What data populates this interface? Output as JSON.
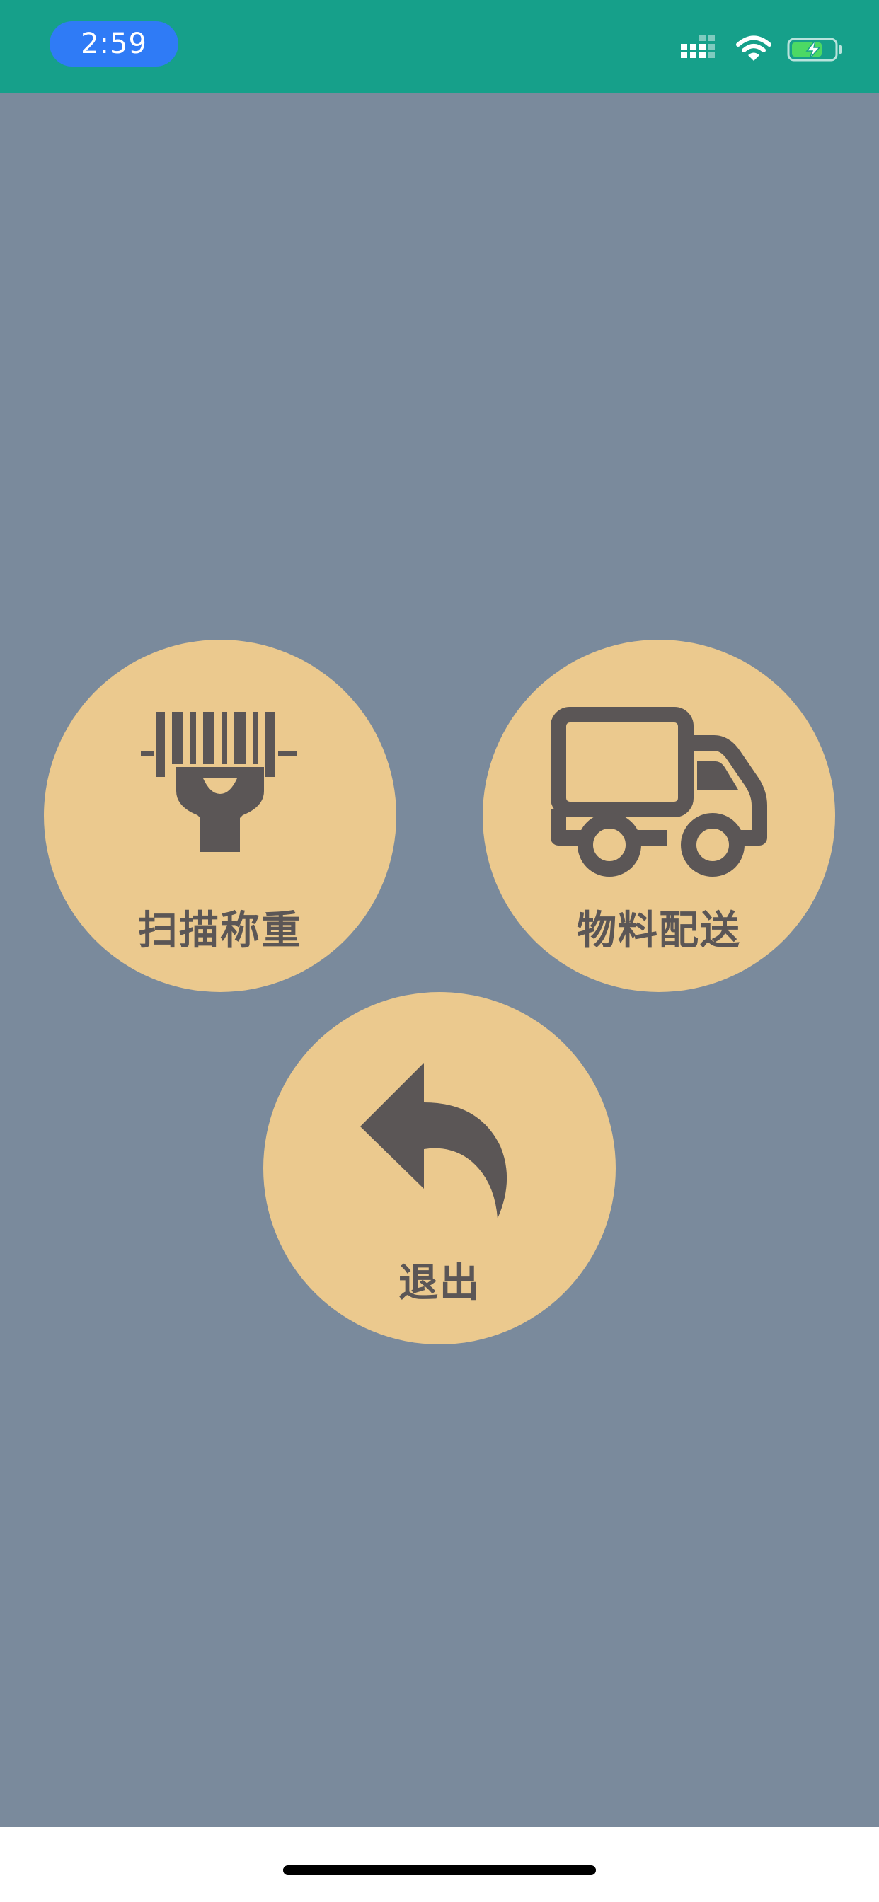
{
  "status_bar": {
    "time": "2:59",
    "background_color": "#16a08a",
    "pill_color": "#2f7bf6",
    "icons": [
      "signal-icon",
      "wifi-icon",
      "battery-charging-icon"
    ]
  },
  "menu": {
    "background_color": "#7a8a9c",
    "button_color": "#ebc98e",
    "text_color": "#5b5656",
    "buttons": [
      {
        "label": "扫描称重",
        "icon": "barcode-scanner-icon"
      },
      {
        "label": "物料配送",
        "icon": "delivery-truck-icon"
      },
      {
        "label": "退出",
        "icon": "back-arrow-icon"
      }
    ]
  }
}
